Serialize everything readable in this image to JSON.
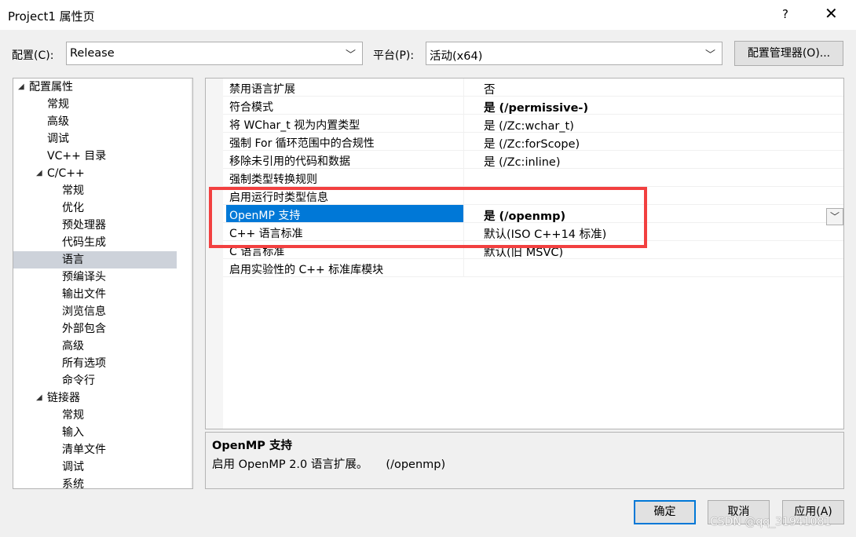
{
  "window": {
    "title": "Project1 属性页",
    "help_label": "?",
    "close_label": "✕"
  },
  "config": {
    "config_label": "配置(C):",
    "config_value": "Release",
    "platform_label": "平台(P):",
    "platform_value": "活动(x64)",
    "manager_button": "配置管理器(O)..."
  },
  "tree": {
    "items": [
      {
        "label": "配置属性",
        "level": 0,
        "expanded": true
      },
      {
        "label": "常规",
        "level": 1
      },
      {
        "label": "高级",
        "level": 1
      },
      {
        "label": "调试",
        "level": 1
      },
      {
        "label": "VC++ 目录",
        "level": 1
      },
      {
        "label": "C/C++",
        "level": 1,
        "expanded": true
      },
      {
        "label": "常规",
        "level": 2
      },
      {
        "label": "优化",
        "level": 2
      },
      {
        "label": "预处理器",
        "level": 2
      },
      {
        "label": "代码生成",
        "level": 2
      },
      {
        "label": "语言",
        "level": 2,
        "selected": true
      },
      {
        "label": "预编译头",
        "level": 2
      },
      {
        "label": "输出文件",
        "level": 2
      },
      {
        "label": "浏览信息",
        "level": 2
      },
      {
        "label": "外部包含",
        "level": 2
      },
      {
        "label": "高级",
        "level": 2
      },
      {
        "label": "所有选项",
        "level": 2
      },
      {
        "label": "命令行",
        "level": 2
      },
      {
        "label": "链接器",
        "level": 1,
        "expanded": true
      },
      {
        "label": "常规",
        "level": 2
      },
      {
        "label": "输入",
        "level": 2
      },
      {
        "label": "清单文件",
        "level": 2
      },
      {
        "label": "调试",
        "level": 2
      },
      {
        "label": "系统",
        "level": 2
      }
    ]
  },
  "properties": [
    {
      "name": "禁用语言扩展",
      "value": "否"
    },
    {
      "name": "符合模式",
      "value": "是 (/permissive-)",
      "bold": true
    },
    {
      "name": "将 WChar_t 视为内置类型",
      "value": "是 (/Zc:wchar_t)"
    },
    {
      "name": "强制 For 循环范围中的合规性",
      "value": "是 (/Zc:forScope)"
    },
    {
      "name": "移除未引用的代码和数据",
      "value": "是 (/Zc:inline)"
    },
    {
      "name": "强制类型转换规则",
      "value": ""
    },
    {
      "name": "启用运行时类型信息",
      "value": ""
    },
    {
      "name": "OpenMP 支持",
      "value": "是 (/openmp)",
      "bold": true,
      "selected": true
    },
    {
      "name": "C++ 语言标准",
      "value": "默认(ISO C++14 标准)"
    },
    {
      "name": "C 语言标准",
      "value": "默认(旧 MSVC)"
    },
    {
      "name": "启用实验性的 C++ 标准库模块",
      "value": ""
    }
  ],
  "description": {
    "title": "OpenMP 支持",
    "text": "启用 OpenMP 2.0 语言扩展。     (/openmp)"
  },
  "buttons": {
    "ok": "确定",
    "cancel": "取消",
    "apply": "应用(A)"
  },
  "watermark": "CSDN @qq_31941081",
  "colors": {
    "selection": "#0078d7",
    "highlight_box": "#f24040",
    "tree_selected": "#cdd2da"
  }
}
